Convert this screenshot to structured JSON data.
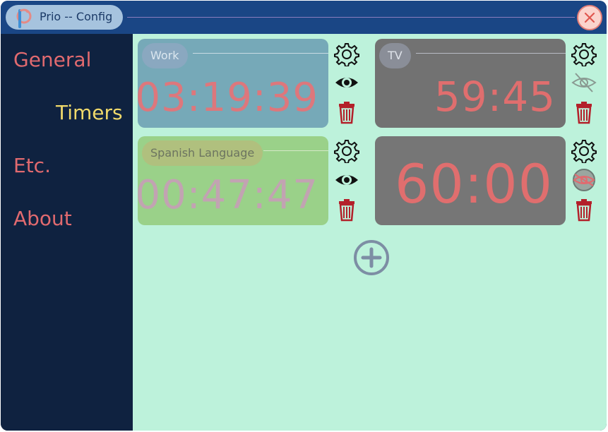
{
  "window": {
    "title": "Prio -- Config",
    "colors": {
      "titlebar": "#1a4685",
      "sidebar": "#0f2240",
      "content": "#bdf2db",
      "nav_text": "#e16a6f",
      "nav_active": "#f0d96a",
      "timer_digits": "#e16a6f",
      "close_button": "#fbd3cd"
    }
  },
  "sidebar": {
    "items": [
      {
        "label": "General",
        "active": false
      },
      {
        "label": "Timers",
        "active": true
      },
      {
        "label": "Etc.",
        "active": false
      },
      {
        "label": "About",
        "active": false
      }
    ]
  },
  "timers": [
    {
      "name": "Work",
      "time": "03:19:39",
      "visible": true,
      "card_color": "#76a9b8",
      "digits_color": "#dd777c",
      "icons": [
        "gear-icon",
        "eye-icon",
        "trash-icon"
      ]
    },
    {
      "name": "TV",
      "time": "59:45",
      "visible": false,
      "card_color": "#727272",
      "digits_color": "#e06e6e",
      "icons": [
        "gear-icon",
        "eye-off-icon",
        "trash-icon"
      ]
    },
    {
      "name": "Spanish Language",
      "time": "00:47:47",
      "visible": true,
      "card_color": "#9ad189",
      "digits_color": "#c2a3b2",
      "icons": [
        "gear-icon",
        "eye-icon",
        "trash-icon"
      ]
    },
    {
      "name": "",
      "time": "60:00",
      "visible": false,
      "card_color": "#767676",
      "digits_color": "#e06e6e",
      "icons": [
        "gear-icon",
        "eye-off-icon",
        "trash-icon"
      ]
    }
  ],
  "actions": {
    "add_timer_icon": "plus-circle-icon",
    "close_icon": "close-icon"
  }
}
